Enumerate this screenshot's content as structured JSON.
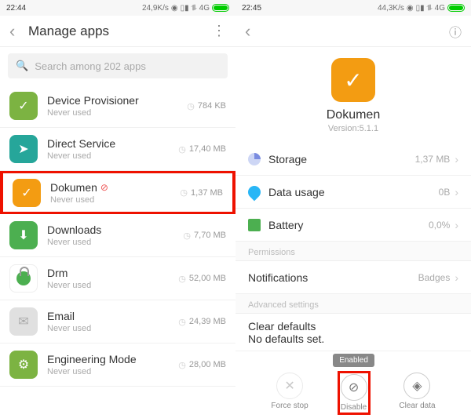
{
  "left": {
    "status": {
      "time": "22:44",
      "speed": "24,9K/s",
      "net": "4G"
    },
    "title": "Manage apps",
    "search_placeholder": "Search among 202 apps",
    "apps": [
      {
        "name": "Device Provisioner",
        "sub": "Never used",
        "size": "784 KB",
        "icon": "green",
        "glyph": "✓"
      },
      {
        "name": "Direct Service",
        "sub": "Never used",
        "size": "17,40 MB",
        "icon": "teal",
        "glyph": "➤"
      },
      {
        "name": "Dokumen",
        "sub": "Never used",
        "size": "1,37 MB",
        "icon": "orange",
        "glyph": "✓",
        "disabled": true,
        "highlight": true
      },
      {
        "name": "Downloads",
        "sub": "Never used",
        "size": "7,70 MB",
        "icon": "dgreen",
        "glyph": "⬇"
      },
      {
        "name": "Drm",
        "sub": "Never used",
        "size": "52,00 MB",
        "icon": "padlock",
        "glyph": ""
      },
      {
        "name": "Email",
        "sub": "Never used",
        "size": "24,39 MB",
        "icon": "grey",
        "glyph": "✉"
      },
      {
        "name": "Engineering Mode",
        "sub": "Never used",
        "size": "28,00 MB",
        "icon": "green",
        "glyph": "⚙"
      }
    ]
  },
  "right": {
    "status": {
      "time": "22:45",
      "speed": "44,3K/s",
      "net": "4G"
    },
    "app": {
      "name": "Dokumen",
      "version": "Version:5.1.1"
    },
    "rows": {
      "storage": {
        "label": "Storage",
        "val": "1,37 MB"
      },
      "data": {
        "label": "Data usage",
        "val": "0B"
      },
      "battery": {
        "label": "Battery",
        "val": "0,0%"
      },
      "notif": {
        "label": "Notifications",
        "val": "Badges"
      },
      "clear": {
        "label": "Clear defaults",
        "sub": "No defaults set."
      }
    },
    "sections": {
      "perm": "Permissions",
      "adv": "Advanced settings"
    },
    "actions": {
      "forcestop": "Force stop",
      "disable": "Disable",
      "cleardata": "Clear data",
      "tooltip": "Enabled"
    }
  }
}
